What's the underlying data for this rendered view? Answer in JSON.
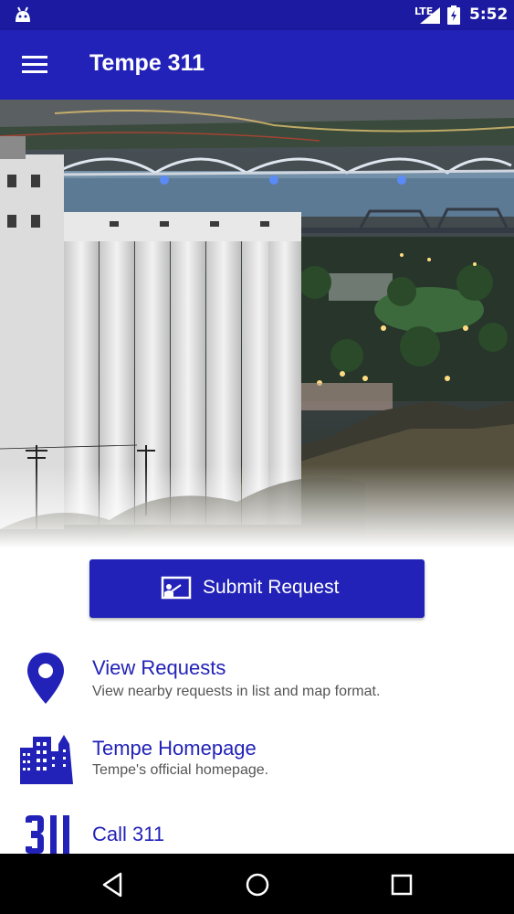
{
  "status_bar": {
    "network": "LTE",
    "time": "5:52"
  },
  "app_bar": {
    "title": "Tempe 311",
    "menu_icon": "hamburger-menu-icon"
  },
  "submit": {
    "label": "Submit Request",
    "icon": "submit-request-icon"
  },
  "items": [
    {
      "title": "View Requests",
      "subtitle": "View nearby requests in list and map format.",
      "icon": "map-pin-icon"
    },
    {
      "title": "Tempe Homepage",
      "subtitle": "Tempe's official homepage.",
      "icon": "city-buildings-icon"
    },
    {
      "title": "Call 311",
      "subtitle": "",
      "icon": "call-311-icon"
    }
  ],
  "colors": {
    "primary": "#2222b8",
    "status_bar": "#1c1aa0"
  }
}
